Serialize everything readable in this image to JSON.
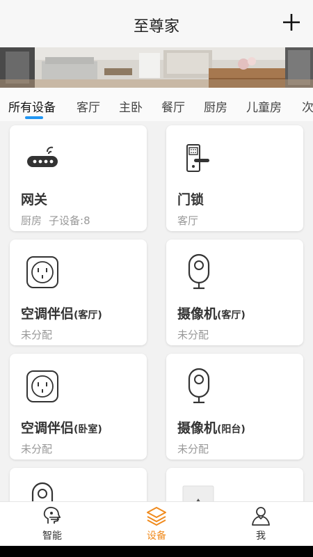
{
  "header": {
    "title": "至尊家",
    "add_icon": "plus-icon"
  },
  "banner": {
    "image": "living-room-photo"
  },
  "tabs": [
    {
      "label": "所有设备",
      "active": true
    },
    {
      "label": "客厅",
      "active": false
    },
    {
      "label": "主卧",
      "active": false
    },
    {
      "label": "餐厅",
      "active": false
    },
    {
      "label": "厨房",
      "active": false
    },
    {
      "label": "儿童房",
      "active": false
    },
    {
      "label": "次",
      "active": false
    }
  ],
  "devices": [
    {
      "name": "网关",
      "name_suffix": "",
      "room": "厨房",
      "extra": "子设备:8",
      "icon": "gateway-icon"
    },
    {
      "name": "门锁",
      "name_suffix": "",
      "room": "客厅",
      "extra": "",
      "icon": "door-lock-icon"
    },
    {
      "name": "空调伴侣",
      "name_suffix": "(客厅)",
      "room": "未分配",
      "extra": "",
      "icon": "ac-companion-icon"
    },
    {
      "name": "摄像机",
      "name_suffix": "(客厅)",
      "room": "未分配",
      "extra": "",
      "icon": "camera-icon"
    },
    {
      "name": "空调伴侣",
      "name_suffix": "(卧室)",
      "room": "未分配",
      "extra": "",
      "icon": "ac-companion-icon"
    },
    {
      "name": "摄像机",
      "name_suffix": "(阳台)",
      "room": "未分配",
      "extra": "",
      "icon": "camera-icon"
    }
  ],
  "bottom_nav": [
    {
      "label": "智能",
      "icon": "smart-icon",
      "active": false
    },
    {
      "label": "设备",
      "icon": "devices-icon",
      "active": true
    },
    {
      "label": "我",
      "icon": "profile-icon",
      "active": false
    }
  ],
  "colors": {
    "accent_blue": "#2196f3",
    "active_orange": "#f08a1c"
  }
}
